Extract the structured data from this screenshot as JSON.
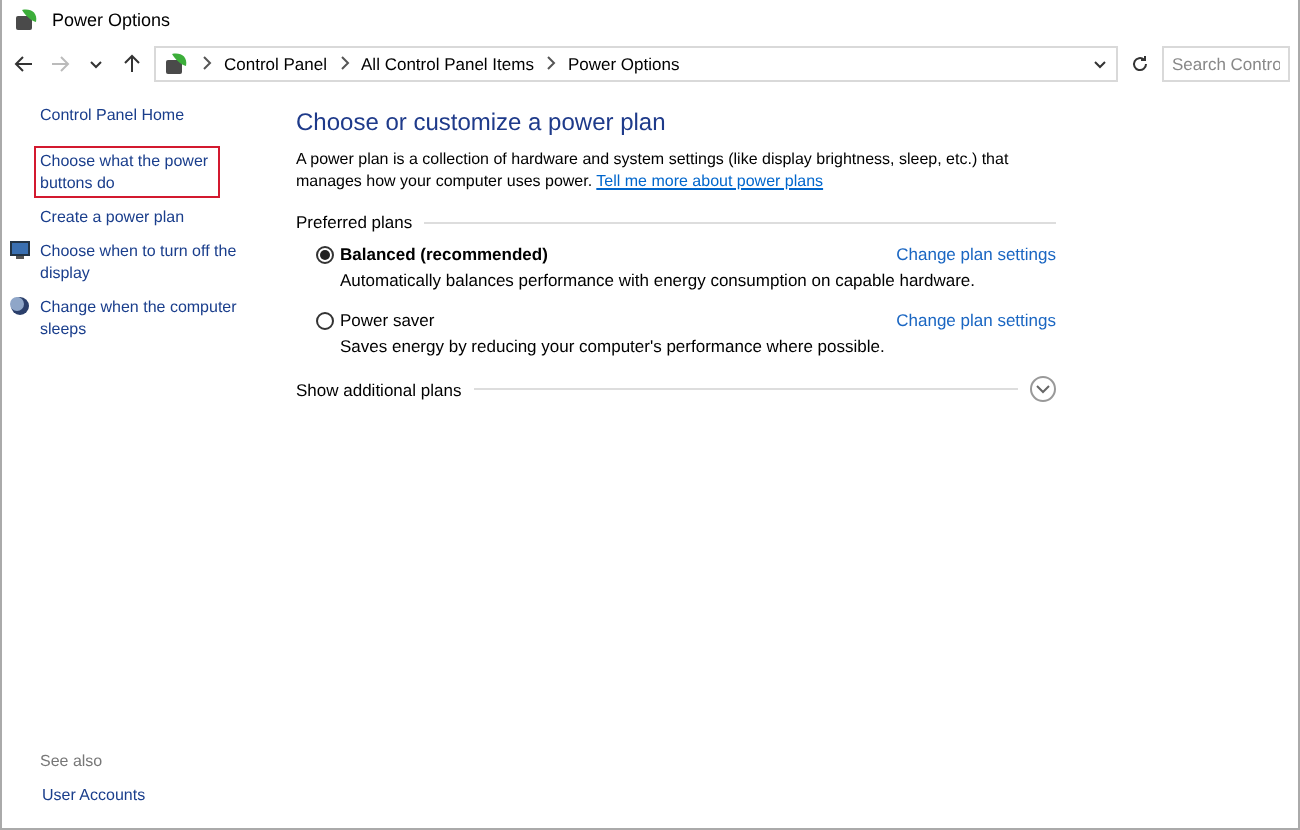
{
  "window": {
    "title": "Power Options"
  },
  "address_bar": {
    "crumbs": [
      "Control Panel",
      "All Control Panel Items",
      "Power Options"
    ],
    "search_placeholder": "Search Contro"
  },
  "sidebar": {
    "items": [
      {
        "label": "Control Panel Home",
        "kind": "plain",
        "highlighted": false
      },
      {
        "label": "Choose what the power buttons do",
        "kind": "plain",
        "highlighted": true
      },
      {
        "label": "Create a power plan",
        "kind": "plain",
        "highlighted": false
      },
      {
        "label": "Choose when to turn off the display",
        "kind": "display",
        "highlighted": false
      },
      {
        "label": "Change when the computer sleeps",
        "kind": "sleep",
        "highlighted": false
      }
    ],
    "see_also": {
      "heading": "See also",
      "links": [
        "User Accounts"
      ]
    }
  },
  "main": {
    "heading": "Choose or customize a power plan",
    "description": "A power plan is a collection of hardware and system settings (like display brightness, sleep, etc.) that manages how your computer uses power.",
    "description_link": "Tell me more about power plans",
    "group_label": "Preferred plans",
    "plans": [
      {
        "name": "Balanced (recommended)",
        "selected": true,
        "detail": "Automatically balances performance with energy consumption on capable hardware.",
        "link": "Change plan settings"
      },
      {
        "name": "Power saver",
        "selected": false,
        "detail": "Saves energy by reducing your computer's performance where possible.",
        "link": "Change plan settings"
      }
    ],
    "more": {
      "label": "Show additional plans",
      "expanded": false
    }
  }
}
